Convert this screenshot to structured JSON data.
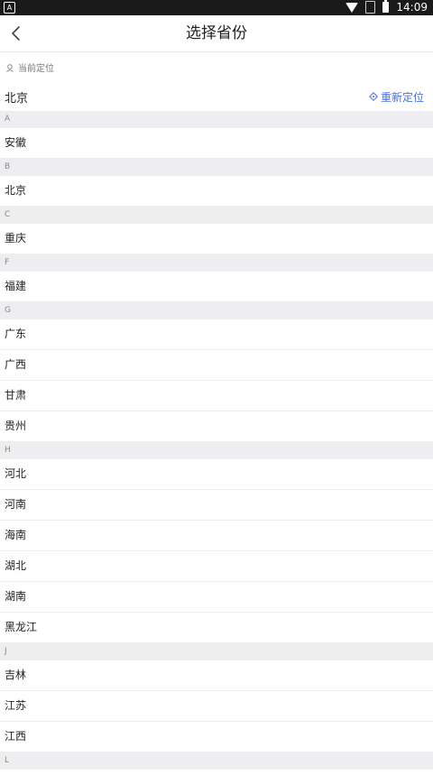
{
  "status": {
    "time": "14:09"
  },
  "header": {
    "title": "选择省份"
  },
  "location": {
    "label": "当前定位",
    "city": "北京",
    "relocate": "重新定位"
  },
  "sections": [
    {
      "letter": "A",
      "items": [
        "安徽"
      ]
    },
    {
      "letter": "B",
      "items": [
        "北京"
      ]
    },
    {
      "letter": "C",
      "items": [
        "重庆"
      ]
    },
    {
      "letter": "F",
      "items": [
        "福建"
      ]
    },
    {
      "letter": "G",
      "items": [
        "广东",
        "广西",
        "甘肃",
        "贵州"
      ]
    },
    {
      "letter": "H",
      "items": [
        "河北",
        "河南",
        "海南",
        "湖北",
        "湖南",
        "黑龙江"
      ]
    },
    {
      "letter": "J",
      "items": [
        "吉林",
        "江苏",
        "江西"
      ]
    },
    {
      "letter": "L",
      "items": []
    }
  ]
}
